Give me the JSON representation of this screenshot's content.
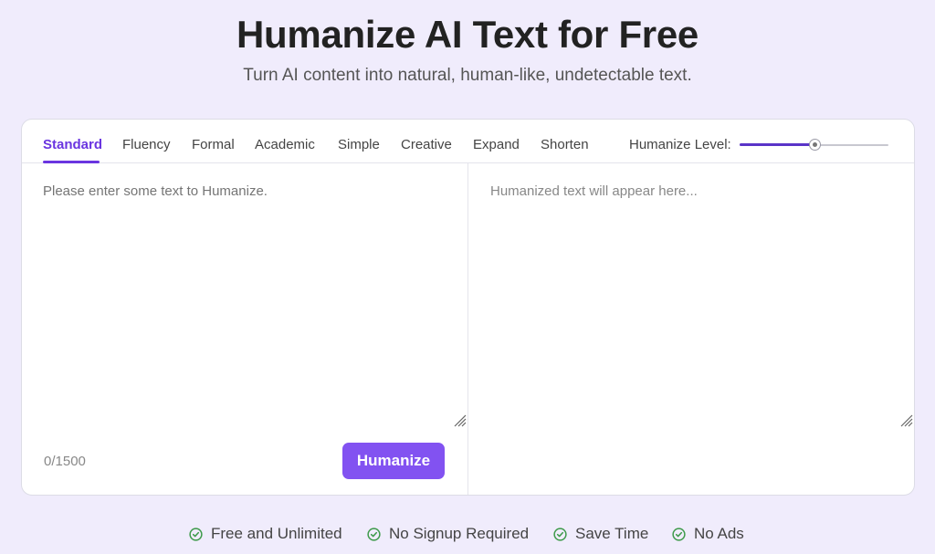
{
  "hero": {
    "title": "Humanize AI Text for Free",
    "subtitle": "Turn AI content into natural, human-like, undetectable text."
  },
  "tabs": [
    {
      "label": "Standard",
      "active": true
    },
    {
      "label": "Fluency",
      "active": false
    },
    {
      "label": "Formal",
      "active": false
    },
    {
      "label": "Academic",
      "active": false
    },
    {
      "label": "Simple",
      "active": false
    },
    {
      "label": "Creative",
      "active": false
    },
    {
      "label": "Expand",
      "active": false
    },
    {
      "label": "Shorten",
      "active": false
    }
  ],
  "humanize_level": {
    "label": "Humanize Level:",
    "value_fraction": 0.5
  },
  "input": {
    "placeholder": "Please enter some text to Humanize.",
    "value": "",
    "char_count": "0/1500"
  },
  "output": {
    "placeholder": "Humanized text will appear here..."
  },
  "actions": {
    "humanize_label": "Humanize"
  },
  "features": [
    {
      "label": "Free and Unlimited",
      "icon": "check-circle-icon"
    },
    {
      "label": "No Signup Required",
      "icon": "check-circle-icon"
    },
    {
      "label": "Save Time",
      "icon": "check-circle-icon"
    },
    {
      "label": "No Ads",
      "icon": "check-circle-icon"
    }
  ],
  "colors": {
    "accent": "#6a35e0",
    "button": "#8252f1",
    "background": "#f0ecfc",
    "check": "#3d9a4a"
  }
}
